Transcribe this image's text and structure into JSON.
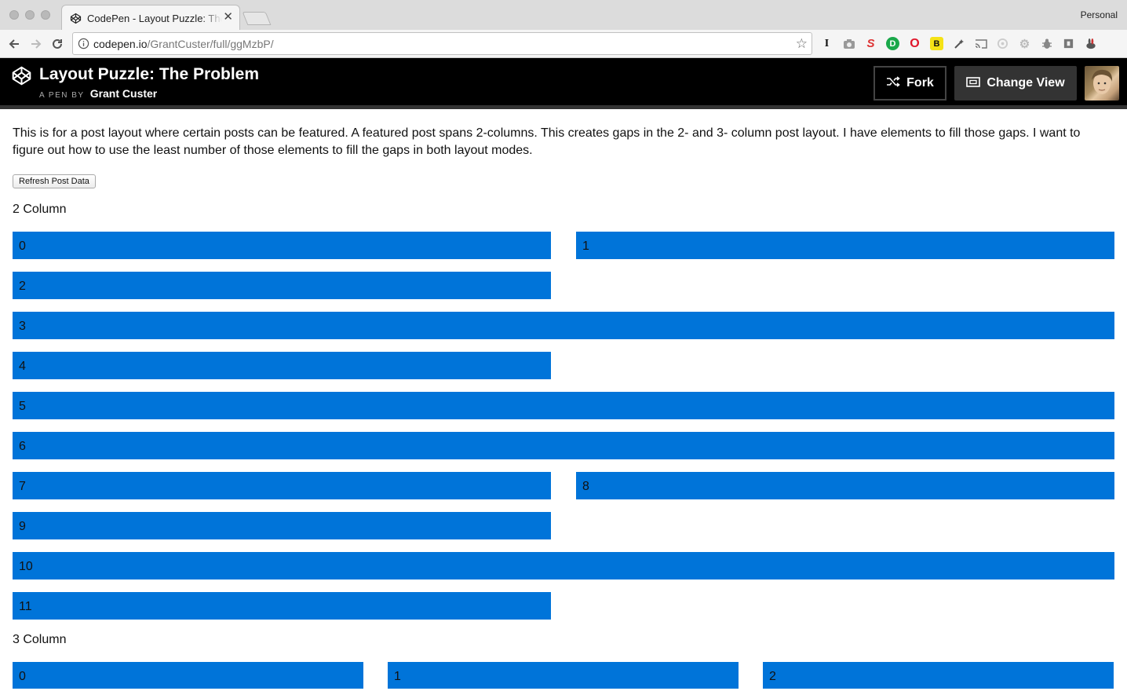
{
  "browser": {
    "tab_title": "CodePen - Layout Puzzle: The Problem",
    "profile": "Personal",
    "url_host": "codepen.io",
    "url_path": "/GrantCuster/full/ggMzbP/",
    "extensions": [
      "I",
      "camera-icon",
      "S",
      "D",
      "O",
      "B",
      "wand-icon",
      "cast-icon",
      "circle-icon",
      "gear-icon",
      "bug-icon",
      "puzzle-icon",
      "rabbit-icon"
    ]
  },
  "pen": {
    "title": "Layout Puzzle: The Problem",
    "by_label": "A PEN BY",
    "author": "Grant Custer",
    "fork_label": "Fork",
    "change_view_label": "Change View"
  },
  "content": {
    "intro": "This is for a post layout where certain posts can be featured. A featured post spans 2-columns. This creates gaps in the 2- and 3- column post layout. I have elements to fill those gaps. I want to figure out how to use the least number of those elements to fill the gaps in both layout modes.",
    "refresh_label": "Refresh Post Data",
    "two_col_label": "2 Column",
    "three_col_label": "3 Column"
  },
  "two_column_posts": [
    {
      "label": "0",
      "featured": false
    },
    {
      "label": "1",
      "featured": false
    },
    {
      "label": "2",
      "featured": false
    },
    {
      "label": "3",
      "featured": true
    },
    {
      "label": "4",
      "featured": false
    },
    {
      "label": "5",
      "featured": true
    },
    {
      "label": "6",
      "featured": true
    },
    {
      "label": "7",
      "featured": false
    },
    {
      "label": "8",
      "featured": false
    },
    {
      "label": "9",
      "featured": false
    },
    {
      "label": "10",
      "featured": true
    },
    {
      "label": "11",
      "featured": false
    }
  ],
  "three_column_posts": [
    {
      "label": "0",
      "featured": false
    },
    {
      "label": "1",
      "featured": false
    },
    {
      "label": "2",
      "featured": false
    }
  ],
  "colors": {
    "post_blue": "#0074d9",
    "header_black": "#000000"
  }
}
